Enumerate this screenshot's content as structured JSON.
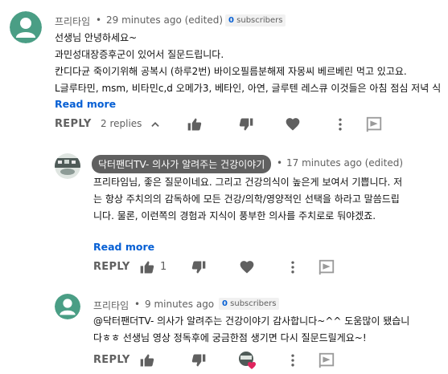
{
  "comment": {
    "author": "프리타임",
    "time": "29 minutes ago (edited)",
    "subscribers_count": "0",
    "subscribers_label": "subscribers",
    "lines": [
      "선생님 안녕하세요~",
      "과민성대장증후군이 있어서 질문드립니다.",
      "칸디다균 죽이기위해 공복시 (하루2번) 바이오필름분해제 자몽씨 베르베린 먹고 있고요.",
      "L글루타민, msm, 비타민c,d 오메가3, 베타인, 아연, 글루텐 레스큐 이것들은 아침 점심  저녁 식"
    ],
    "read_more": "Read more",
    "reply": "REPLY",
    "replies_toggle": "2 replies"
  },
  "reply1": {
    "author": "닥터팬더TV- 의사가 알려주는 건강이야기",
    "time": "17 minutes ago (edited)",
    "lines": [
      "프리타임님, 좋은 질문이네요. 그리고 건강의식이 높은게 보여서 기쁩니다. 저",
      "는 항상 주치의의 감독하에 모든 건강/의학/영양적인 선택을 하라고 말씀드립",
      "니다. 물론, 이런쪽의 경험과 지식이 풍부한 의사를 주치로로 둬야겠죠."
    ],
    "read_more": "Read more",
    "reply": "REPLY",
    "likes": "1"
  },
  "reply2": {
    "author": "프리타임",
    "time": "9 minutes ago",
    "subscribers_count": "0",
    "subscribers_label": "subscribers",
    "lines": [
      "@닥터팬더TV- 의사가 알려주는 건강이야기 감사합니다~^^ 도움많이 됐습니",
      "다ㅎㅎ 선생님 영상 정독후에 궁금한점 생기면 다시 질문드릴게요~!"
    ],
    "reply": "REPLY"
  },
  "colors": {
    "avatar_teal": "#4a9e85",
    "link_blue": "#065fd4",
    "icon_gray": "#606060",
    "heart_red": "#e0245e"
  },
  "icons": [
    "thumbs-up-icon",
    "thumbs-down-icon",
    "heart-icon",
    "more-vert-icon",
    "flag-icon",
    "chevron-up-icon"
  ]
}
